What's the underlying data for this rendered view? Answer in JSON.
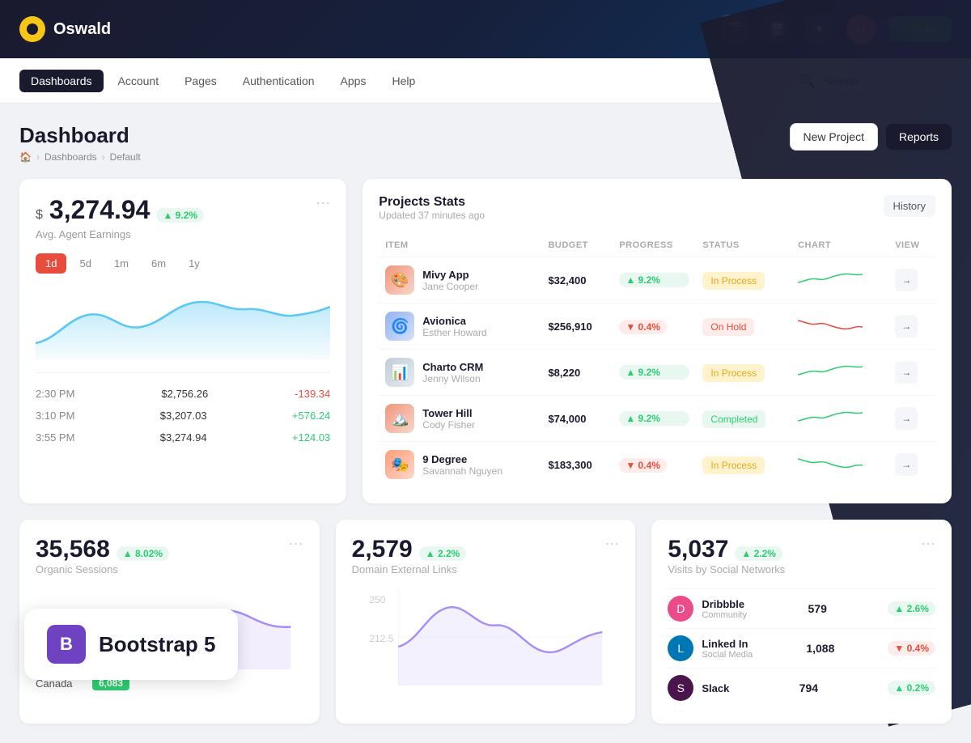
{
  "app": {
    "name": "Oswald",
    "invite_label": "+ Invite"
  },
  "navbar": {
    "items": [
      {
        "label": "Dashboards",
        "active": true
      },
      {
        "label": "Account",
        "active": false
      },
      {
        "label": "Pages",
        "active": false
      },
      {
        "label": "Authentication",
        "active": false
      },
      {
        "label": "Apps",
        "active": false
      },
      {
        "label": "Help",
        "active": false
      }
    ],
    "search_placeholder": "Search..."
  },
  "page": {
    "title": "Dashboard",
    "breadcrumb": [
      "Dashboards",
      "Default"
    ],
    "new_project_label": "New Project",
    "reports_label": "Reports"
  },
  "earnings_card": {
    "currency": "$",
    "amount": "3,274.94",
    "badge": "▲ 9.2%",
    "subtitle": "Avg. Agent Earnings",
    "periods": [
      "1d",
      "5d",
      "1m",
      "6m",
      "1y"
    ],
    "active_period": "1d",
    "rows": [
      {
        "time": "2:30 PM",
        "value": "$2,756.26",
        "change": "-139.34",
        "positive": false
      },
      {
        "time": "3:10 PM",
        "value": "$3,207.03",
        "change": "+576.24",
        "positive": true
      },
      {
        "time": "3:55 PM",
        "value": "$3,274.94",
        "change": "+124.03",
        "positive": true
      }
    ]
  },
  "projects_card": {
    "title": "Projects Stats",
    "subtitle": "Updated 37 minutes ago",
    "history_label": "History",
    "columns": [
      "ITEM",
      "BUDGET",
      "PROGRESS",
      "STATUS",
      "CHART",
      "VIEW"
    ],
    "rows": [
      {
        "name": "Mivy App",
        "person": "Jane Cooper",
        "budget": "$32,400",
        "progress": "▲ 9.2%",
        "progress_positive": true,
        "status": "In Process",
        "status_class": "inprocess",
        "color": "#e8623a",
        "emoji": "🎨"
      },
      {
        "name": "Avionica",
        "person": "Esther Howard",
        "budget": "$256,910",
        "progress": "▼ 0.4%",
        "progress_positive": false,
        "status": "On Hold",
        "status_class": "onhold",
        "color": "#5b8dee",
        "emoji": "🌀"
      },
      {
        "name": "Charto CRM",
        "person": "Jenny Wilson",
        "budget": "$8,220",
        "progress": "▲ 9.2%",
        "progress_positive": true,
        "status": "In Process",
        "status_class": "inprocess",
        "color": "#a0b4c8",
        "emoji": "📊"
      },
      {
        "name": "Tower Hill",
        "person": "Cody Fisher",
        "budget": "$74,000",
        "progress": "▲ 9.2%",
        "progress_positive": true,
        "status": "Completed",
        "status_class": "completed",
        "color": "#e8623a",
        "emoji": "🏔️"
      },
      {
        "name": "9 Degree",
        "person": "Savannah Nguyen",
        "budget": "$183,300",
        "progress": "▼ 0.4%",
        "progress_positive": false,
        "status": "In Process",
        "status_class": "inprocess",
        "color": "#ff6b35",
        "emoji": "🎭"
      }
    ]
  },
  "sessions_card": {
    "amount": "35,568",
    "badge": "▲ 8.02%",
    "subtitle": "Organic Sessions",
    "country": "Canada",
    "country_val": "6,083"
  },
  "links_card": {
    "amount": "2,579",
    "badge": "▲ 2.2%",
    "subtitle": "Domain External Links"
  },
  "social_card": {
    "amount": "5,037",
    "badge": "▲ 2.2%",
    "subtitle": "Visits by Social Networks",
    "networks": [
      {
        "name": "Dribbble",
        "type": "Community",
        "value": "579",
        "change": "▲ 2.6%",
        "positive": true,
        "color": "#ea4c89"
      },
      {
        "name": "Linked In",
        "type": "Social Media",
        "value": "1,088",
        "change": "▼ 0.4%",
        "positive": false,
        "color": "#0077b5"
      },
      {
        "name": "Slack",
        "type": "",
        "value": "794",
        "change": "▲ 0.2%",
        "positive": true,
        "color": "#4a154b"
      }
    ]
  },
  "bootstrap_overlay": {
    "label": "Bootstrap 5"
  }
}
